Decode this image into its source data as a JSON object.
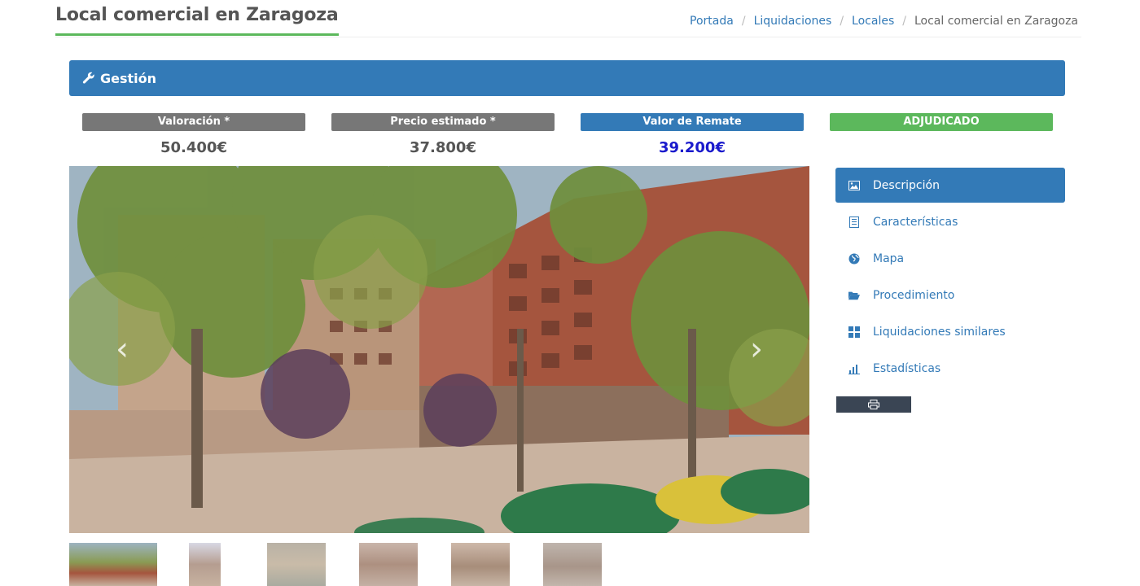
{
  "header": {
    "title": "Local comercial en Zaragoza",
    "breadcrumb": [
      "Portada",
      "Liquidaciones",
      "Locales"
    ],
    "breadcrumb_current": "Local comercial en Zaragoza"
  },
  "gestion": {
    "label": "Gestión"
  },
  "prices": [
    {
      "label": "Valoración *",
      "value": "50.400€",
      "color": "#777777"
    },
    {
      "label": "Precio estimado *",
      "value": "37.800€",
      "color": "#777777"
    },
    {
      "label": "Valor de Remate",
      "value": "39.200€",
      "color": "#337ab7"
    },
    {
      "label": "ADJUDICADO",
      "value": "",
      "color": "#5cb85c"
    }
  ],
  "side_nav": [
    {
      "label": "Descripción",
      "icon": "picture-icon",
      "active": true
    },
    {
      "label": "Características",
      "icon": "list-icon",
      "active": false
    },
    {
      "label": "Mapa",
      "icon": "globe-icon",
      "active": false
    },
    {
      "label": "Procedimiento",
      "icon": "folder-open-icon",
      "active": false
    },
    {
      "label": "Liquidaciones similares",
      "icon": "grid-icon",
      "active": false
    },
    {
      "label": "Estadísticas",
      "icon": "bar-chart-icon",
      "active": false
    }
  ],
  "print": {
    "icon": "print-icon"
  },
  "carousel": {
    "prev_icon": "chevron-left-icon",
    "next_icon": "chevron-right-icon"
  },
  "thumbnails": {
    "count": 6
  },
  "colors": {
    "primary": "#337ab7",
    "success": "#5cb85c",
    "muted": "#777777",
    "remate_value": "#1a1acc"
  }
}
